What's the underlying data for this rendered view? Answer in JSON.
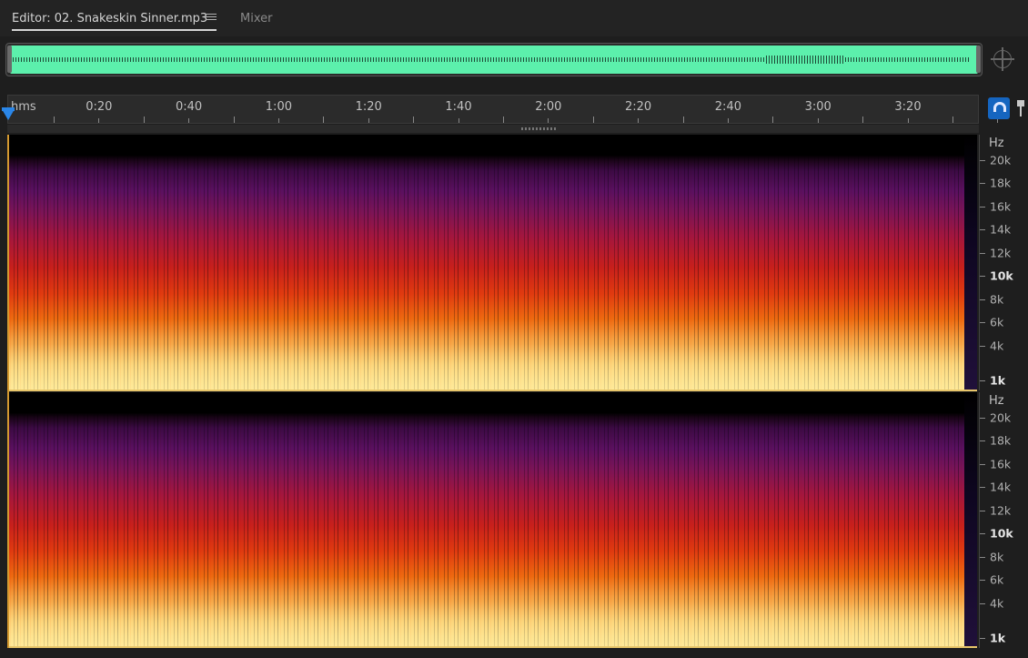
{
  "tabs": {
    "editor_label": "Editor: 02. Snakeskin Sinner.mp3",
    "mixer_label": "Mixer"
  },
  "ruler": {
    "unit": "hms",
    "labels": [
      {
        "text": "0:20",
        "seconds": 20
      },
      {
        "text": "0:40",
        "seconds": 40
      },
      {
        "text": "1:00",
        "seconds": 60
      },
      {
        "text": "1:20",
        "seconds": 80
      },
      {
        "text": "1:40",
        "seconds": 100
      },
      {
        "text": "2:00",
        "seconds": 120
      },
      {
        "text": "2:20",
        "seconds": 140
      },
      {
        "text": "2:40",
        "seconds": 160
      },
      {
        "text": "3:00",
        "seconds": 180
      },
      {
        "text": "3:20",
        "seconds": 200
      }
    ]
  },
  "frequency_axis": {
    "unit": "Hz",
    "labels": [
      {
        "text": "20k",
        "hz": 20000,
        "bold": false
      },
      {
        "text": "18k",
        "hz": 18000,
        "bold": false
      },
      {
        "text": "16k",
        "hz": 16000,
        "bold": false
      },
      {
        "text": "14k",
        "hz": 14000,
        "bold": false
      },
      {
        "text": "12k",
        "hz": 12000,
        "bold": false
      },
      {
        "text": "10k",
        "hz": 10000,
        "bold": true
      },
      {
        "text": "8k",
        "hz": 8000,
        "bold": false
      },
      {
        "text": "6k",
        "hz": 6000,
        "bold": false
      },
      {
        "text": "4k",
        "hz": 4000,
        "bold": false
      },
      {
        "text": "1k",
        "hz": 1000,
        "bold": true
      }
    ]
  },
  "colors": {
    "overview_waveform": "#5cf0ac",
    "playhead": "#2a86e8",
    "snap_button": "#1565c0"
  },
  "icons": {
    "tab_menu": "hamburger-menu-icon",
    "zoom": "zoom-target-icon",
    "snap": "magnet-snap-icon",
    "marker": "marker-pin-icon",
    "playhead": "playhead-icon"
  }
}
